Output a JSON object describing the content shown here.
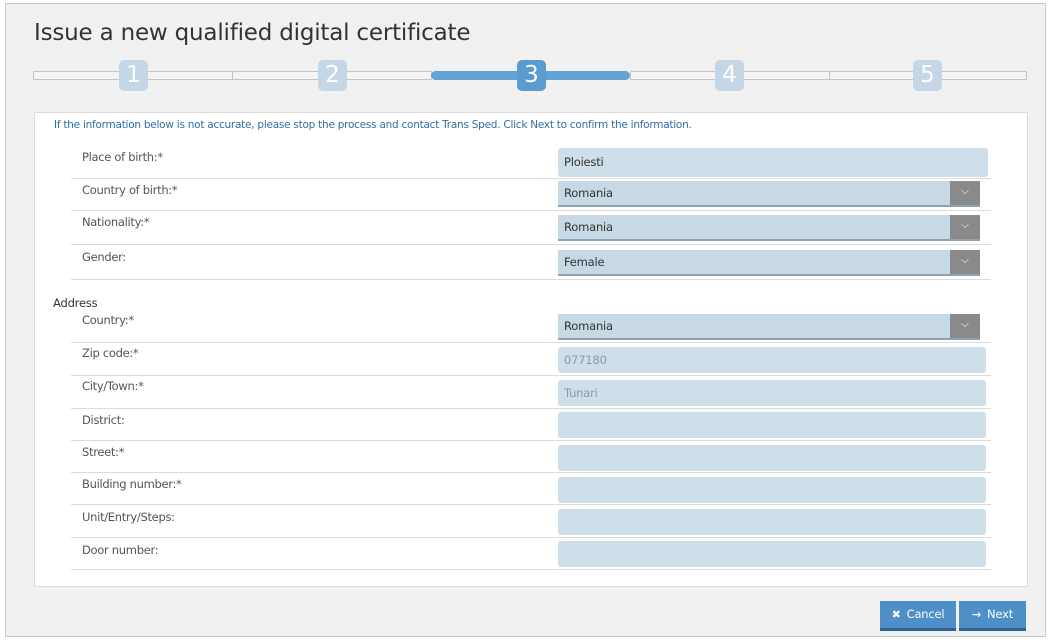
{
  "page": {
    "title": "Issue a new qualified digital certificate"
  },
  "stepper": {
    "steps": [
      "1",
      "2",
      "3",
      "4",
      "5"
    ],
    "current": 3
  },
  "notice": "If the information below is not accurate, please stop the process and contact Trans Sped. Click Next to confirm the information.",
  "personal": {
    "place_of_birth": {
      "label": "Place of birth:*",
      "value": "Ploiesti"
    },
    "country_of_birth": {
      "label": "Country of birth:*",
      "value": "Romania"
    },
    "nationality": {
      "label": "Nationality:*",
      "value": "Romania"
    },
    "gender": {
      "label": "Gender:",
      "value": "Female"
    }
  },
  "address": {
    "heading": "Address",
    "country": {
      "label": "Country:*",
      "value": "Romania"
    },
    "zip": {
      "label": "Zip code:*",
      "value": "077180"
    },
    "city": {
      "label": "City/Town:*",
      "value": "Tunari"
    },
    "district": {
      "label": "District:",
      "value": ""
    },
    "street": {
      "label": "Street:*",
      "value": ""
    },
    "building": {
      "label": "Building number:*",
      "value": ""
    },
    "unit": {
      "label": "Unit/Entry/Steps:",
      "value": ""
    },
    "door": {
      "label": "Door number:",
      "value": ""
    }
  },
  "icons": {
    "dropdown": "chevron-down-icon",
    "cancel": "close-icon",
    "next": "arrow-right-icon"
  },
  "buttons": {
    "cancel": "Cancel",
    "next": "Next"
  },
  "colors": {
    "accent": "#5b9cd0",
    "field": "#cfdfea",
    "notice": "#2f6fa6"
  }
}
